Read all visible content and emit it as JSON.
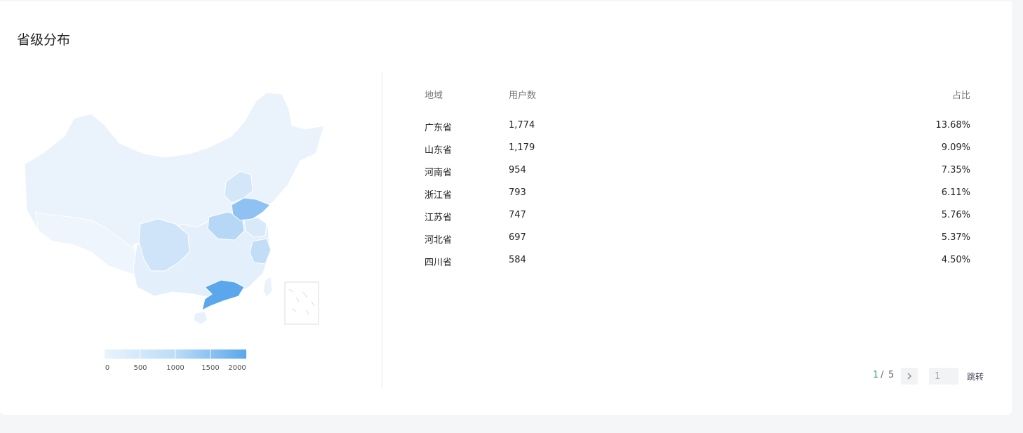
{
  "section": {
    "title": "省级分布"
  },
  "legend": {
    "labels": [
      "0",
      "500",
      "1000",
      "1500",
      "2000"
    ],
    "min": 0,
    "max": 2000
  },
  "colors": {
    "low": "#e9f4fd",
    "high": "#5aa7ec",
    "positive": "#38a169"
  },
  "table": {
    "headers": {
      "region": "地域",
      "users": "用户数",
      "share": "占比"
    },
    "rows": [
      {
        "region": "广东省",
        "users": "1,774",
        "share": "13.68%"
      },
      {
        "region": "山东省",
        "users": "1,179",
        "share": "9.09%"
      },
      {
        "region": "河南省",
        "users": "954",
        "share": "7.35%"
      },
      {
        "region": "浙江省",
        "users": "793",
        "share": "6.11%"
      },
      {
        "region": "江苏省",
        "users": "747",
        "share": "5.76%"
      },
      {
        "region": "河北省",
        "users": "697",
        "share": "5.37%"
      },
      {
        "region": "四川省",
        "users": "584",
        "share": "4.50%"
      }
    ]
  },
  "pagination": {
    "current": "1",
    "separator": "/",
    "total": "5",
    "input_value": "1",
    "jump_label": "跳转"
  }
}
